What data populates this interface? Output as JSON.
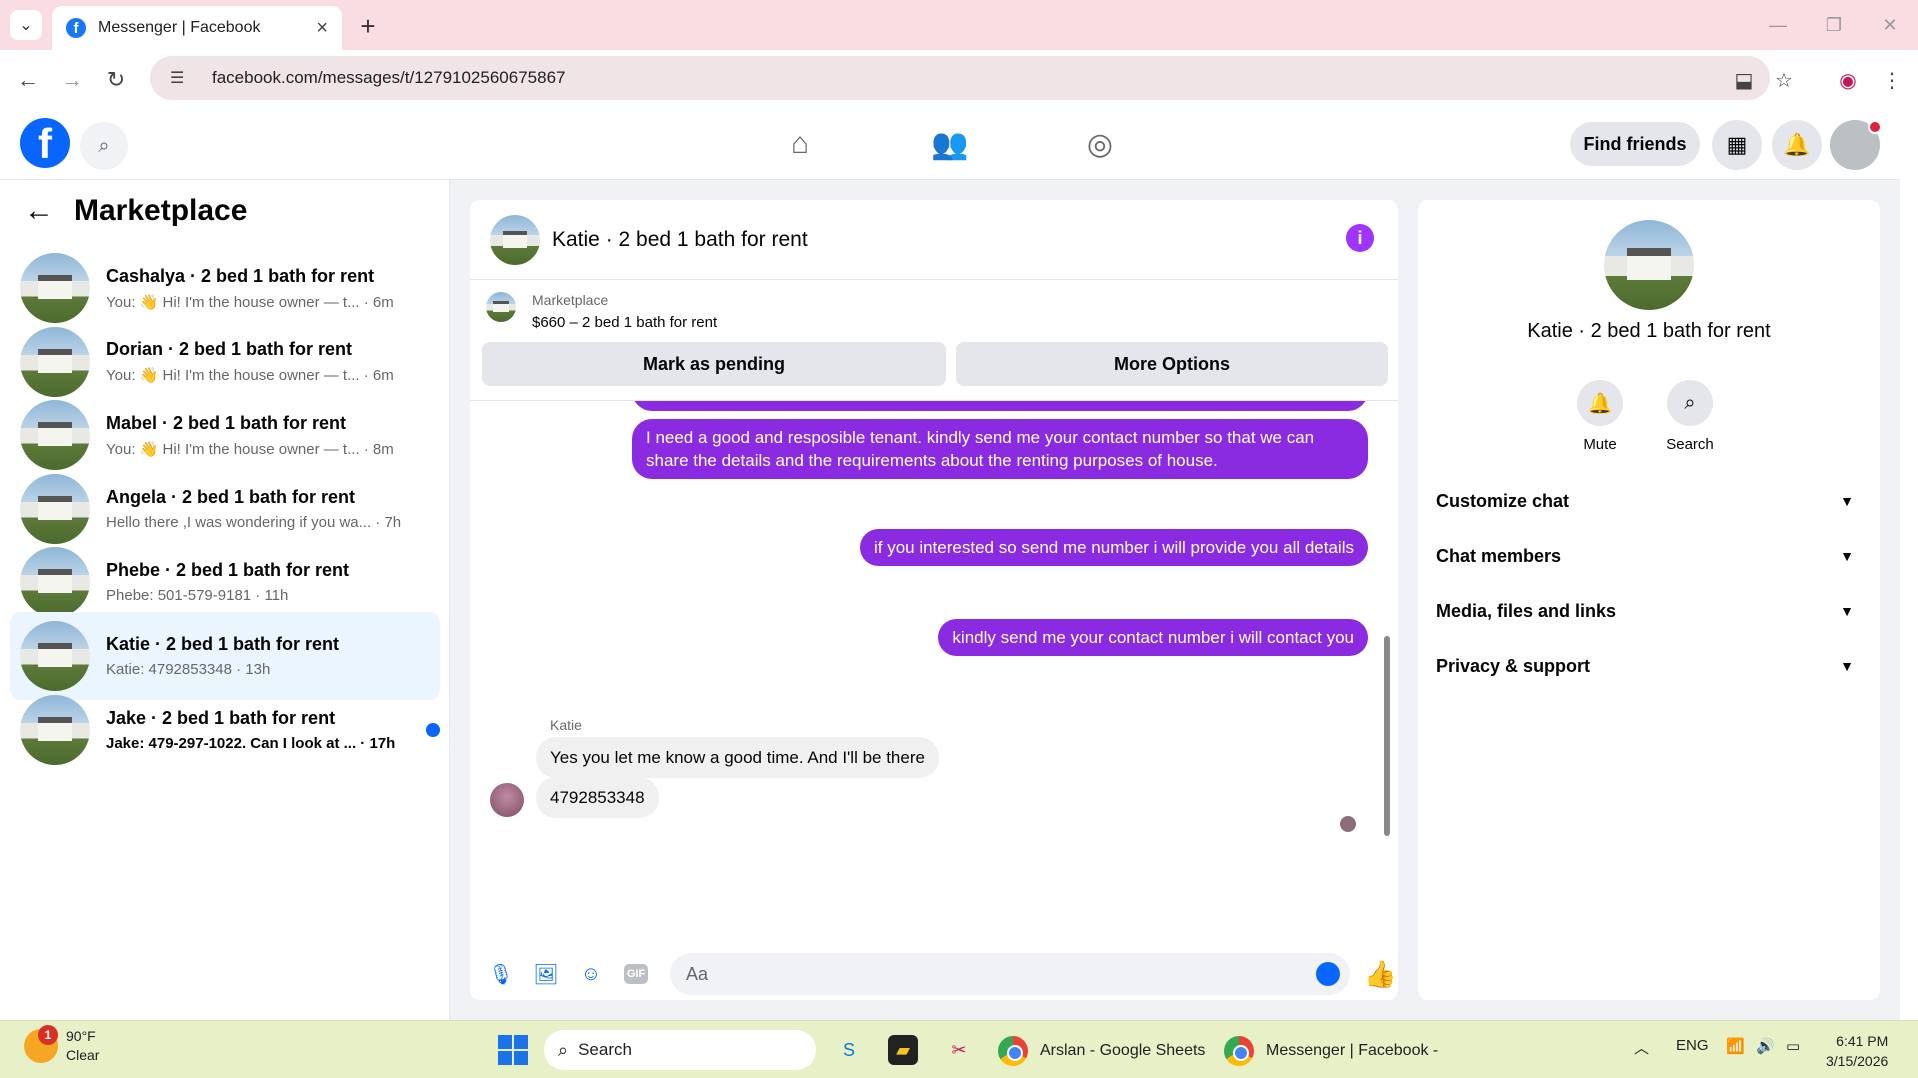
{
  "browser": {
    "tab_title": "Messenger | Facebook",
    "url": "facebook.com/messages/t/1279102560675867"
  },
  "fb": {
    "find_friends": "Find friends"
  },
  "sidebar": {
    "title": "Marketplace",
    "conversations": [
      {
        "name": "Cashalya · 2 bed 1 bath for rent",
        "snippet": "You: 👋 Hi! I'm the house owner — t... · 6m",
        "unread": false,
        "active": false
      },
      {
        "name": "Dorian · 2 bed 1 bath for rent",
        "snippet": "You: 👋 Hi! I'm the house owner — t... · 6m",
        "unread": false,
        "active": false
      },
      {
        "name": "Mabel · 2 bed 1 bath for rent",
        "snippet": "You: 👋 Hi! I'm the house owner — t... · 8m",
        "unread": false,
        "active": false
      },
      {
        "name": "Angela · 2 bed 1 bath for rent",
        "snippet": "Hello there ,I was wondering if you wa... · 7h",
        "unread": false,
        "active": false
      },
      {
        "name": "Phebe · 2 bed 1 bath for rent",
        "snippet": "Phebe: 501-579-9181 · 11h",
        "unread": false,
        "active": false
      },
      {
        "name": "Katie · 2 bed 1 bath for rent",
        "snippet": "Katie: 4792853348 · 13h",
        "unread": false,
        "active": true
      },
      {
        "name": "Jake · 2 bed 1 bath for rent",
        "snippet": "Jake: 479-297-1022. Can I look at ... · 17h",
        "unread": true,
        "active": false
      }
    ]
  },
  "chat": {
    "title": "Katie · 2 bed 1 bath for rent",
    "marketplace_label": "Marketplace",
    "listing": "$660 – 2 bed 1 bath for rent",
    "mark_pending": "Mark as pending",
    "more_options": "More Options",
    "messages_out": [
      "I need a good and resposible tenant.  kindly send me your contact number so that we can share the details and the requirements about the renting purposes of house.",
      "if you interested so send me number i will provide you all details",
      "kindly send me your contact number i will contact you"
    ],
    "sender": "Katie",
    "messages_in": [
      "Yes you let me know a good time. And I'll be there",
      "4792853348"
    ],
    "input_placeholder": "Aa",
    "gif_label": "GIF"
  },
  "info": {
    "name": "Katie · 2 bed 1 bath for rent",
    "mute": "Mute",
    "search": "Search",
    "sections": [
      "Customize chat",
      "Chat members",
      "Media, files and links",
      "Privacy & support"
    ]
  },
  "taskbar": {
    "weather_badge": "1",
    "temp": "90°F",
    "condition": "Clear",
    "search": "Search",
    "task1": "Arslan - Google Sheets",
    "task2": "Messenger | Facebook -",
    "lang": "ENG",
    "time": "6:41 PM",
    "date": "3/15/2026"
  }
}
